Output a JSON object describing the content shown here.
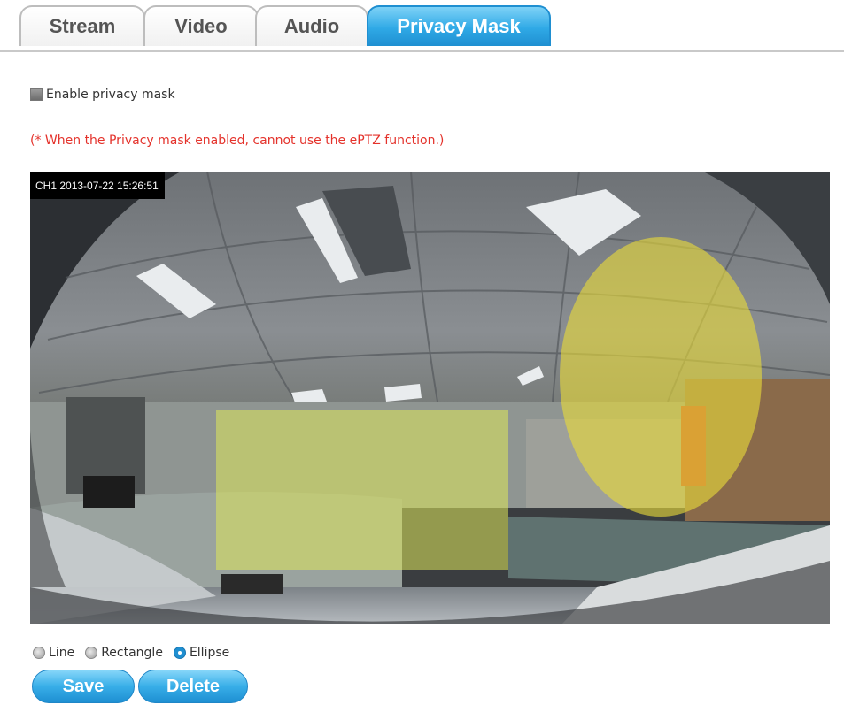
{
  "tabs": [
    {
      "label": "Stream",
      "active": false
    },
    {
      "label": "Video",
      "active": false
    },
    {
      "label": "Audio",
      "active": false
    },
    {
      "label": "Privacy Mask",
      "active": true
    }
  ],
  "privacy": {
    "enable_label": "Enable privacy mask",
    "enabled": false,
    "warning": "(* When the Privacy mask enabled, cannot use the ePTZ function.)"
  },
  "video": {
    "osd_text": "CH1 2013-07-22 15:26:51",
    "mask_color": "#e6e65a"
  },
  "shape_options": [
    {
      "label": "Line",
      "selected": false
    },
    {
      "label": "Rectangle",
      "selected": false
    },
    {
      "label": "Ellipse",
      "selected": true
    }
  ],
  "buttons": {
    "save_label": "Save",
    "delete_label": "Delete"
  },
  "colors": {
    "accent": "#2fa9e6",
    "warning": "#e4322b"
  }
}
